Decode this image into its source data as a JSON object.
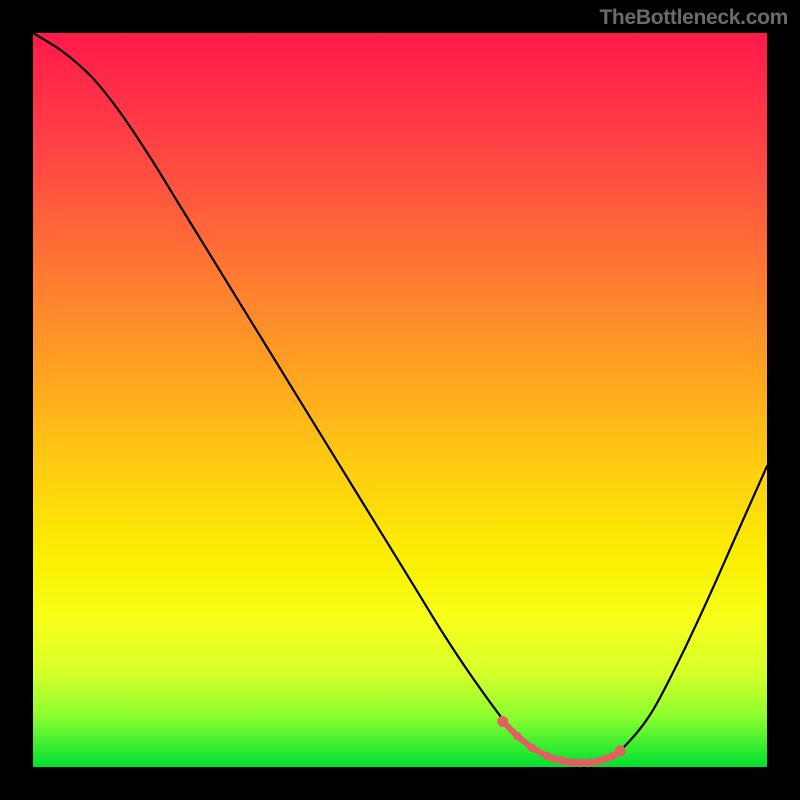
{
  "watermark": "TheBottleneck.com",
  "colors": {
    "background": "#000000",
    "gradient_top": "#ff1a49",
    "gradient_bottom": "#00e030",
    "curve": "#000000",
    "markers": "#e16060"
  },
  "chart_data": {
    "type": "line",
    "title": "",
    "xlabel": "",
    "ylabel": "",
    "xlim": [
      0,
      100
    ],
    "ylim": [
      0,
      100
    ],
    "x": [
      0,
      4,
      8,
      12,
      16,
      20,
      24,
      28,
      32,
      36,
      40,
      44,
      48,
      52,
      56,
      60,
      64,
      66,
      68,
      70,
      72,
      74,
      76,
      78,
      80,
      84,
      88,
      92,
      96,
      100
    ],
    "values": [
      100,
      97.5,
      94,
      89,
      83,
      76.5,
      70,
      63.5,
      57,
      50.5,
      44,
      37.5,
      31,
      24.5,
      18,
      12,
      6.5,
      4.2,
      2.6,
      1.5,
      0.9,
      0.6,
      0.6,
      1.1,
      2.2,
      7,
      14.5,
      23,
      32,
      41
    ],
    "markers_x": [
      64,
      66,
      68,
      70,
      71,
      72,
      73,
      74,
      75,
      76,
      77,
      78,
      79,
      80
    ],
    "markers_y": [
      6.2,
      4.2,
      2.6,
      1.5,
      1.1,
      0.9,
      0.7,
      0.6,
      0.6,
      0.6,
      0.8,
      1.1,
      1.5,
      2.2
    ]
  }
}
